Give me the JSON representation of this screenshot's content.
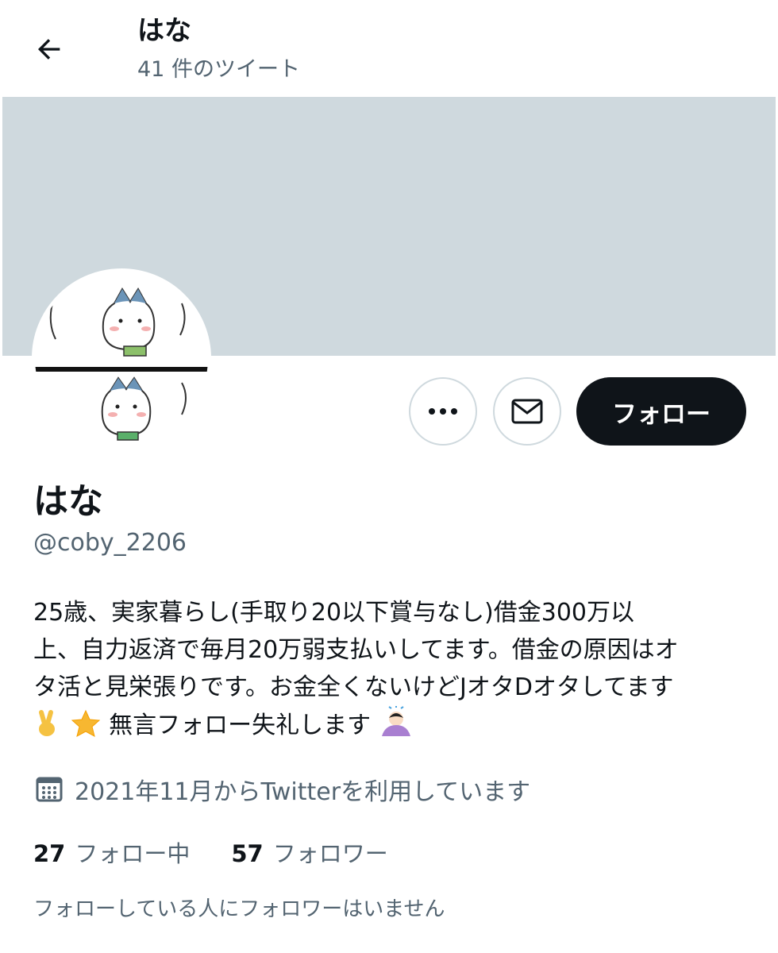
{
  "header": {
    "name": "はな",
    "tweet_count": "41 件のツイート"
  },
  "actions": {
    "follow_label": "フォロー"
  },
  "profile": {
    "name": "はな",
    "handle": "@coby_2206",
    "bio_lines": [
      "25歳、実家暮らし(手取り20以下賞与なし)借金300万以",
      "上、自力返済で毎月20万弱支払いしてます。借金の原因はオ",
      "タ活と見栄張りです。お金全くないけどJオタDオタしてます",
      "無言フォロー失礼します"
    ],
    "joined": "2021年11月からTwitterを利用しています",
    "following_count": "27",
    "following_label": "フォロー中",
    "followers_count": "57",
    "followers_label": "フォロワー",
    "followers_note": "フォローしている人にフォロワーはいません"
  },
  "icons": {
    "back": "arrow-left-icon",
    "more": "more-dots-icon",
    "mail": "envelope-icon",
    "calendar": "calendar-icon",
    "emoji_peace": "victory-hand-emoji",
    "emoji_star": "glowing-star-emoji",
    "emoji_bow": "bowing-person-emoji"
  },
  "colors": {
    "banner": "#cfd9de",
    "text_primary": "#0f1419",
    "text_secondary": "#536471",
    "follow_button_bg": "#0f1419",
    "follow_button_text": "#ffffff"
  }
}
